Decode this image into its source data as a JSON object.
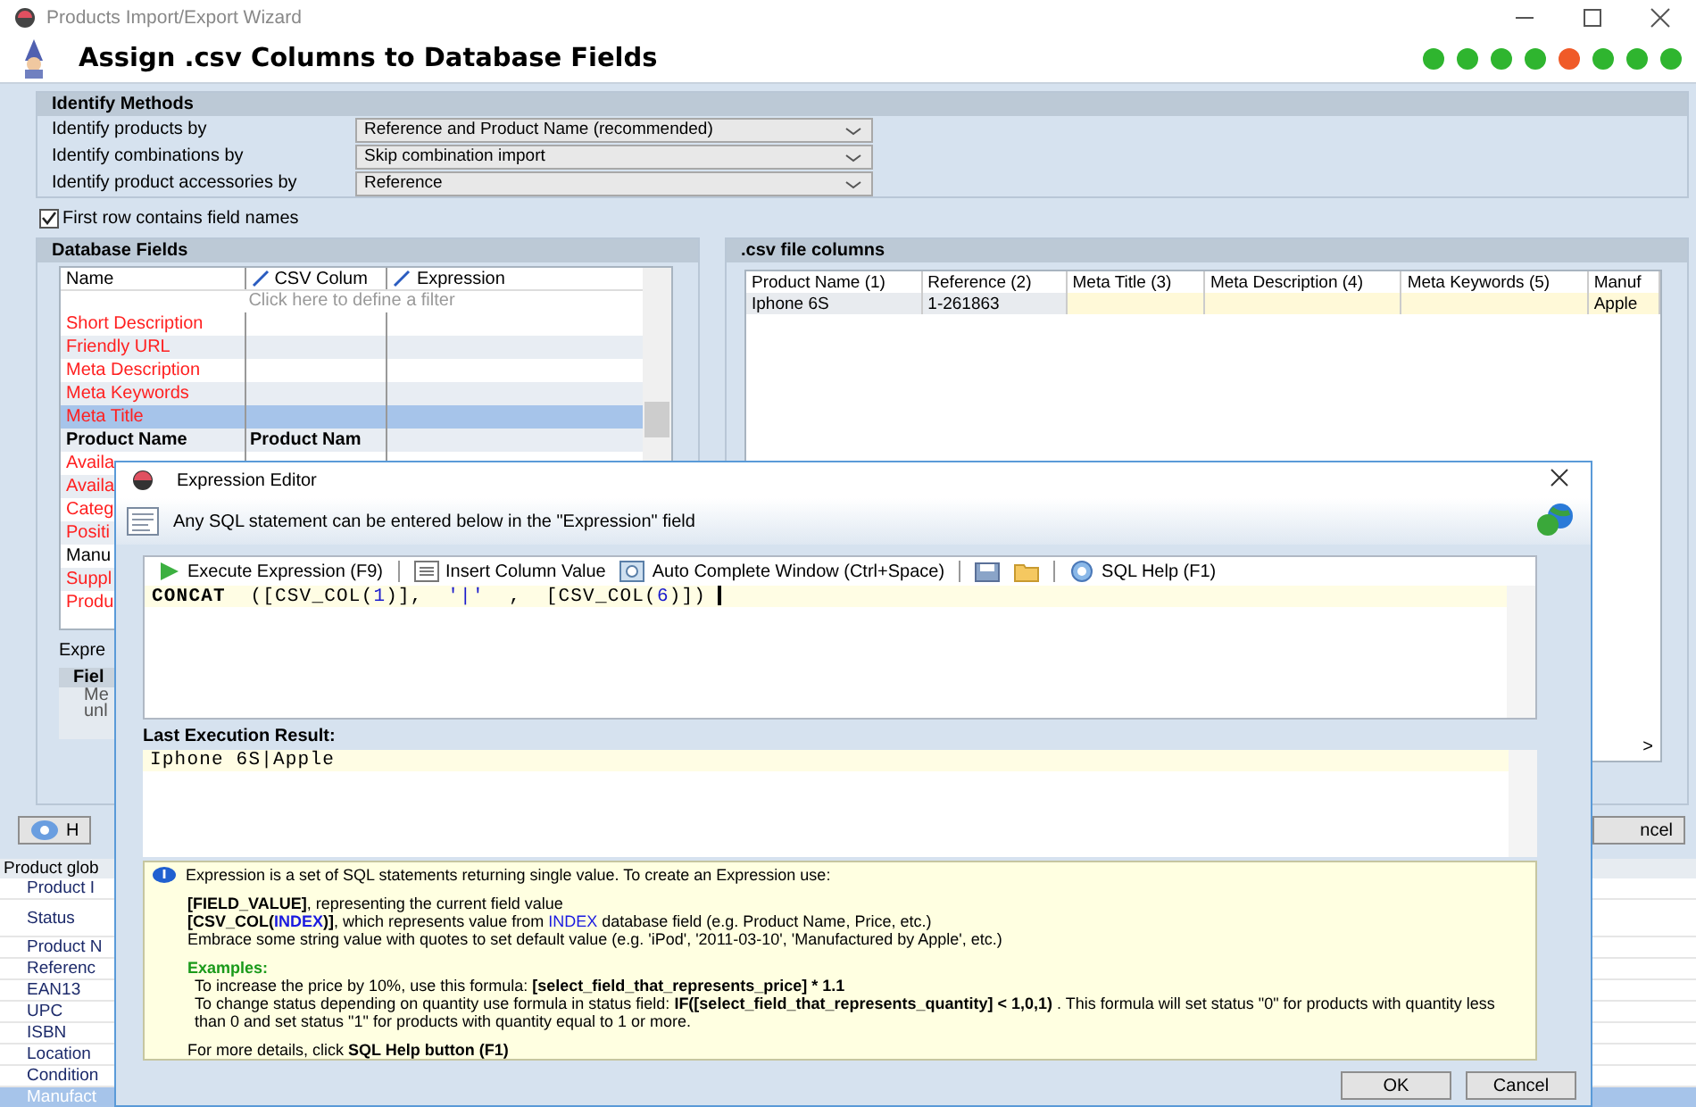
{
  "window": {
    "title": "Products Import/Export Wizard"
  },
  "header": {
    "title": "Assign .csv Columns to Database Fields"
  },
  "steps": [
    {
      "color": "#2fb52f"
    },
    {
      "color": "#2fb52f"
    },
    {
      "color": "#2fb52f"
    },
    {
      "color": "#2fb52f"
    },
    {
      "color": "#f05a28"
    },
    {
      "color": "#2fb52f"
    },
    {
      "color": "#2fb52f"
    },
    {
      "color": "#2fb52f"
    }
  ],
  "identify_methods": {
    "title": "Identify Methods",
    "rows": [
      {
        "label": "Identify products by",
        "value": "Reference and Product Name (recommended)"
      },
      {
        "label": "Identify combinations by",
        "value": "Skip combination import"
      },
      {
        "label": "Identify product accessories by",
        "value": "Reference"
      }
    ]
  },
  "first_row_names": {
    "label": "First row contains field names",
    "checked": true
  },
  "database_fields": {
    "title": "Database Fields",
    "columns": [
      "Name",
      "CSV Colum",
      "Expression"
    ],
    "filter_hint": "Click here to define a filter",
    "rows": [
      {
        "name": "Short Description",
        "color": "#ff2020",
        "kind": "plain",
        "selected": false
      },
      {
        "name": "Friendly URL",
        "color": "#ff2020",
        "kind": "plain",
        "selected": false
      },
      {
        "name": "Meta Description",
        "color": "#ff2020",
        "kind": "plain",
        "selected": false
      },
      {
        "name": "Meta Keywords",
        "color": "#ff2020",
        "kind": "plain",
        "selected": false
      },
      {
        "name": "Meta Title",
        "color": "#ff2020",
        "kind": "plain",
        "selected": true
      },
      {
        "name": "Product Name",
        "csv_column": "Product Nam",
        "color": "#000000",
        "kind": "mapped",
        "selected": false
      },
      {
        "name": "Availa",
        "color": "#ff2020",
        "kind": "plain",
        "selected": false
      },
      {
        "name": "Availa",
        "color": "#ff2020",
        "kind": "plain",
        "selected": false
      },
      {
        "name": "Categ",
        "color": "#ff2020",
        "kind": "plain",
        "selected": false
      },
      {
        "name": "Positi",
        "color": "#ff2020",
        "kind": "plain",
        "selected": false
      },
      {
        "name": "Manu",
        "color": "#000000",
        "kind": "plain",
        "selected": false
      },
      {
        "name": "Suppl",
        "color": "#ff2020",
        "kind": "plain",
        "selected": false
      },
      {
        "name": "Produ",
        "color": "#ff2020",
        "kind": "plain",
        "selected": false
      }
    ]
  },
  "expression_label": "Expre",
  "field_panel": {
    "header": "Fiel",
    "lines": [
      "Me",
      "unl"
    ]
  },
  "csv_columns": {
    "title": ".csv file columns",
    "columns": [
      "Product Name (1)",
      "Reference (2)",
      "Meta Title (3)",
      "Meta Description (4)",
      "Meta Keywords (5)",
      "Manuf"
    ],
    "rows": [
      {
        "cells": [
          {
            "text": "Iphone 6S",
            "highlighted": false
          },
          {
            "text": "1-261863",
            "highlighted": false
          },
          {
            "highlighted": true
          },
          {
            "highlighted": true
          },
          {
            "highlighted": true
          },
          {
            "text": "Apple",
            "highlighted": true
          }
        ]
      }
    ],
    "scroll_arrow": ">"
  },
  "buttons_row": {
    "help": "H",
    "cancel": "ncel"
  },
  "field_groups": {
    "header": "Product glob",
    "items": [
      {
        "label": "Product I",
        "selected": false
      },
      {
        "label": "Status",
        "selected": false
      },
      {
        "label": "Product N",
        "selected": false
      },
      {
        "label": "Referenc",
        "selected": false
      },
      {
        "label": "EAN13",
        "selected": false
      },
      {
        "label": "UPC",
        "selected": false
      },
      {
        "label": "ISBN",
        "selected": false
      },
      {
        "label": "Location",
        "selected": false
      },
      {
        "label": "Condition",
        "selected": false
      },
      {
        "label": "Manufact",
        "selected": true
      }
    ]
  },
  "dialog": {
    "title": "Expression Editor",
    "info": "Any SQL statement can be entered below in the \"Expression\" field",
    "toolbar": [
      {
        "kind": "execute",
        "label": "Execute Expression (F9)"
      },
      {
        "kind": "insert",
        "label": "Insert Column Value"
      },
      {
        "kind": "autocomplete",
        "label": "Auto Complete Window (Ctrl+Space)"
      },
      {
        "kind": "save"
      },
      {
        "kind": "open"
      },
      {
        "kind": "help",
        "label": "SQL Help (F1)"
      }
    ],
    "expression": [
      {
        "t": "CONCAT",
        "kind": "keyword"
      },
      {
        "t": "  ([CSV_COL(",
        "kind": "text"
      },
      {
        "t": "1",
        "kind": "number"
      },
      {
        "t": ")],  ",
        "kind": "text"
      },
      {
        "t": "'|'",
        "kind": "string"
      },
      {
        "t": "  ,  [CSV_COL(",
        "kind": "text"
      },
      {
        "t": "6",
        "kind": "number"
      },
      {
        "t": ")])",
        "kind": "text"
      }
    ],
    "result_label": "Last Execution Result:",
    "result": "Iphone 6S|Apple",
    "help": {
      "intro": "Expression is a set of SQL statements returning single value. To create an Expression use:",
      "blocks": [
        {
          "kind": "plain",
          "lines": [
            "**[FIELD_VALUE]**, representing the current field value",
            "**[CSV_COL(*INDEX*)]**, which represents value from *INDEX* database field (e.g. Product Name, Price, etc.)",
            "Embrace some string value with quotes to set default value (e.g. 'iPod', '2011-03-10', 'Manufactured by Apple', etc.)"
          ]
        },
        {
          "kind": "examples",
          "title": "Examples:",
          "lines": [
            "To increase the price by 10%, use this formula: **[select_field_that_represents_price] * 1.1**",
            "To change status depending on quantity use formula in status field: **IF([select_field_that_represents_quantity] < 1,0,1)** . This formula will set status \"0\" for products with quantity less than 0 and set status \"1\" for products with quantity equal to 1 or more."
          ]
        },
        {
          "kind": "plain",
          "lines": [
            "For more details, click **SQL Help button (F1)**"
          ]
        }
      ]
    },
    "buttons": [
      "OK",
      "Cancel"
    ]
  }
}
